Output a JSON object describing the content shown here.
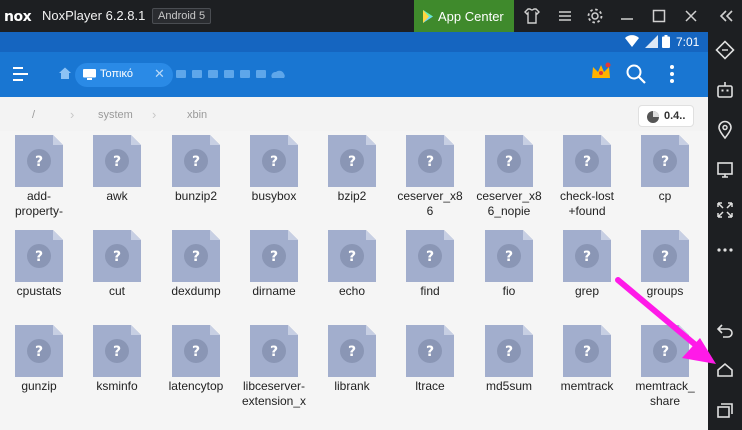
{
  "window": {
    "title": "NoxPlayer 6.2.8.1",
    "android_badge": "Android 5",
    "app_center_label": "App Center",
    "logo_text": "nox"
  },
  "status_bar": {
    "time": "7:01"
  },
  "app_bar": {
    "tab_label": "Τοπικό"
  },
  "breadcrumbs": [
    "/",
    "system",
    "xbin"
  ],
  "storage_label": "0.4..",
  "files": [
    [
      "add-",
      "property-"
    ],
    [
      "awk"
    ],
    [
      "bunzip2"
    ],
    [
      "busybox"
    ],
    [
      "bzip2"
    ],
    [
      "ceserver_x8",
      "6"
    ],
    [
      "ceserver_x8",
      "6_nopie"
    ],
    [
      "check-lost",
      "+found"
    ],
    [
      "cp"
    ],
    [
      "cpustats"
    ],
    [
      "cut"
    ],
    [
      "dexdump"
    ],
    [
      "dirname"
    ],
    [
      "echo"
    ],
    [
      "find"
    ],
    [
      "fio"
    ],
    [
      "grep"
    ],
    [
      "groups"
    ],
    [
      "gunzip"
    ],
    [
      "ksminfo"
    ],
    [
      "latencytop"
    ],
    [
      "libceserver-",
      "extension_x"
    ],
    [
      "librank"
    ],
    [
      "ltrace"
    ],
    [
      "md5sum"
    ],
    [
      "memtrack"
    ],
    [
      "memtrack_",
      "share"
    ]
  ],
  "colors": {
    "status_bar": "#1565c0",
    "app_bar": "#1976d2",
    "app_center": "#3f8a2c",
    "annotation_arrow": "#ff1ae8"
  }
}
